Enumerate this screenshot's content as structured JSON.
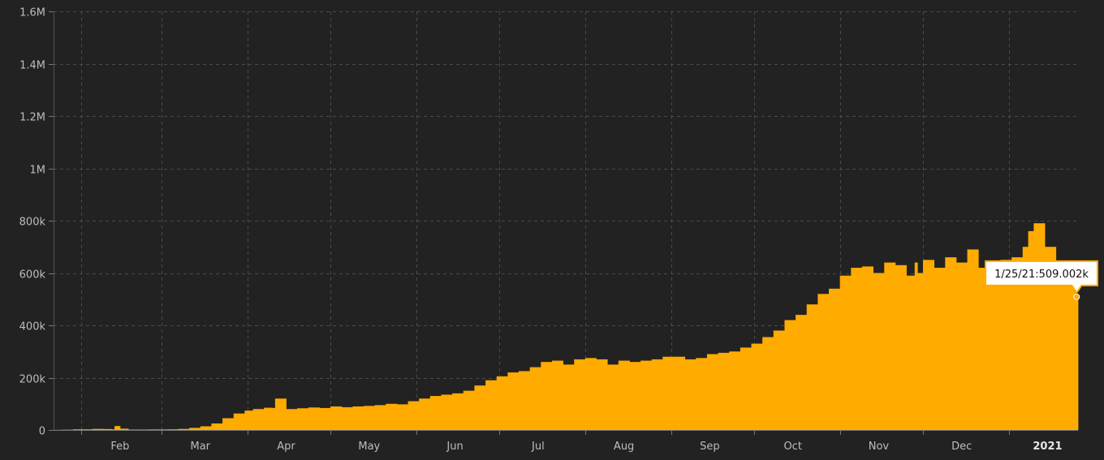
{
  "chart_data": {
    "type": "bar",
    "xlabel": "",
    "ylabel": "",
    "x_start": "2020-01-22",
    "x_end": "2021-01-25",
    "x_ticks": [
      {
        "date": "2020-02-15",
        "label": "Feb",
        "bold": false
      },
      {
        "date": "2020-03-15",
        "label": "Mar",
        "bold": false
      },
      {
        "date": "2020-04-15",
        "label": "Apr",
        "bold": false
      },
      {
        "date": "2020-05-15",
        "label": "May",
        "bold": false
      },
      {
        "date": "2020-06-15",
        "label": "Jun",
        "bold": false
      },
      {
        "date": "2020-07-15",
        "label": "Jul",
        "bold": false
      },
      {
        "date": "2020-08-15",
        "label": "Aug",
        "bold": false
      },
      {
        "date": "2020-09-15",
        "label": "Sep",
        "bold": false
      },
      {
        "date": "2020-10-15",
        "label": "Oct",
        "bold": false
      },
      {
        "date": "2020-11-15",
        "label": "Nov",
        "bold": false
      },
      {
        "date": "2020-12-15",
        "label": "Dec",
        "bold": false
      },
      {
        "date": "2021-01-15",
        "label": "2021",
        "bold": true
      }
    ],
    "grid_dates": [
      "2020-02-01",
      "2020-03-01",
      "2020-04-01",
      "2020-05-01",
      "2020-06-01",
      "2020-07-01",
      "2020-08-01",
      "2020-09-01",
      "2020-10-01",
      "2020-11-01",
      "2020-12-01",
      "2021-01-01"
    ],
    "y_ticks": [
      {
        "value": 0,
        "label": "0"
      },
      {
        "value": 200000,
        "label": "200k"
      },
      {
        "value": 400000,
        "label": "400k"
      },
      {
        "value": 600000,
        "label": "600k"
      },
      {
        "value": 800000,
        "label": "800k"
      },
      {
        "value": 1000000,
        "label": "1M"
      },
      {
        "value": 1200000,
        "label": "1.2M"
      },
      {
        "value": 1400000,
        "label": "1.4M"
      },
      {
        "value": 1600000,
        "label": "1.6M"
      }
    ],
    "ylim": [
      0,
      1600000
    ],
    "grid": true,
    "series": [
      {
        "color": "#ffab00",
        "dates": [
          "2020-01-22",
          "2020-01-25",
          "2020-01-29",
          "2020-02-01",
          "2020-02-05",
          "2020-02-09",
          "2020-02-12",
          "2020-02-13",
          "2020-02-15",
          "2020-02-18",
          "2020-02-21",
          "2020-02-25",
          "2020-02-29",
          "2020-03-03",
          "2020-03-07",
          "2020-03-11",
          "2020-03-15",
          "2020-03-19",
          "2020-03-23",
          "2020-03-27",
          "2020-03-31",
          "2020-04-03",
          "2020-04-07",
          "2020-04-10",
          "2020-04-11",
          "2020-04-15",
          "2020-04-19",
          "2020-04-23",
          "2020-04-27",
          "2020-05-01",
          "2020-05-05",
          "2020-05-09",
          "2020-05-13",
          "2020-05-17",
          "2020-05-21",
          "2020-05-25",
          "2020-05-29",
          "2020-06-02",
          "2020-06-06",
          "2020-06-10",
          "2020-06-14",
          "2020-06-18",
          "2020-06-22",
          "2020-06-26",
          "2020-06-30",
          "2020-07-04",
          "2020-07-08",
          "2020-07-12",
          "2020-07-16",
          "2020-07-20",
          "2020-07-24",
          "2020-07-28",
          "2020-08-01",
          "2020-08-05",
          "2020-08-09",
          "2020-08-13",
          "2020-08-17",
          "2020-08-21",
          "2020-08-25",
          "2020-08-29",
          "2020-09-02",
          "2020-09-06",
          "2020-09-10",
          "2020-09-14",
          "2020-09-18",
          "2020-09-22",
          "2020-09-26",
          "2020-09-30",
          "2020-10-04",
          "2020-10-08",
          "2020-10-12",
          "2020-10-16",
          "2020-10-20",
          "2020-10-24",
          "2020-10-28",
          "2020-11-01",
          "2020-11-05",
          "2020-11-09",
          "2020-11-13",
          "2020-11-17",
          "2020-11-21",
          "2020-11-25",
          "2020-11-28",
          "2020-11-29",
          "2020-12-01",
          "2020-12-05",
          "2020-12-09",
          "2020-12-13",
          "2020-12-17",
          "2020-12-21",
          "2020-12-25",
          "2020-12-29",
          "2021-01-02",
          "2021-01-06",
          "2021-01-08",
          "2021-01-10",
          "2021-01-14",
          "2021-01-18",
          "2021-01-22",
          "2021-01-25"
        ],
        "values": [
          400,
          1000,
          2500,
          2500,
          4000,
          3500,
          2500,
          15000,
          5000,
          1500,
          1500,
          2000,
          2000,
          2500,
          4000,
          8000,
          14000,
          25000,
          45000,
          63000,
          74000,
          80000,
          85000,
          84000,
          120000,
          80000,
          83000,
          86000,
          84000,
          90000,
          87000,
          90000,
          92000,
          95000,
          100000,
          98000,
          110000,
          120000,
          130000,
          135000,
          140000,
          150000,
          170000,
          190000,
          205000,
          220000,
          225000,
          240000,
          260000,
          265000,
          250000,
          270000,
          275000,
          270000,
          250000,
          265000,
          260000,
          265000,
          270000,
          280000,
          280000,
          270000,
          275000,
          290000,
          295000,
          300000,
          315000,
          330000,
          355000,
          380000,
          420000,
          440000,
          480000,
          520000,
          540000,
          590000,
          620000,
          625000,
          600000,
          640000,
          630000,
          590000,
          640000,
          600000,
          650000,
          620000,
          660000,
          640000,
          690000,
          620000,
          560000,
          650000,
          660000,
          700000,
          760000,
          790000,
          700000,
          640000,
          600000,
          509002
        ]
      }
    ],
    "tooltip": {
      "label": "1/25/21:509.002k",
      "date": "2021-01-25",
      "value": 509002
    }
  }
}
